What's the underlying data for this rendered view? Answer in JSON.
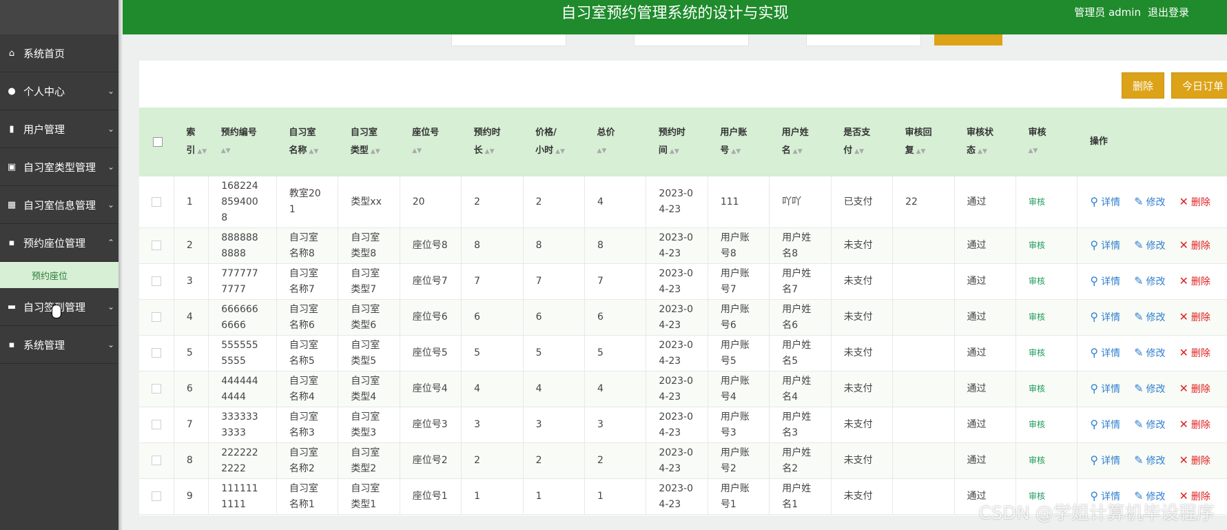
{
  "header": {
    "title": "自习室预约管理系统的设计与实现",
    "user": "管理员 admin",
    "logout": "退出登录"
  },
  "sidebar": {
    "items": [
      {
        "label": "系统首页",
        "icon": "home-icon",
        "glyph": "⌂",
        "arrow": ""
      },
      {
        "label": "个人中心",
        "icon": "user-icon",
        "glyph": "●",
        "arrow": "⌄"
      },
      {
        "label": "用户管理",
        "icon": "user-manage-icon",
        "glyph": "▮",
        "arrow": "⌄"
      },
      {
        "label": "自习室类型管理",
        "icon": "clipboard-icon",
        "glyph": "▣",
        "arrow": "⌄"
      },
      {
        "label": "自习室信息管理",
        "icon": "grid-icon",
        "glyph": "▦",
        "arrow": "⌄"
      },
      {
        "label": "预约座位管理",
        "icon": "apps-icon",
        "glyph": "▪",
        "arrow": "⌃"
      },
      {
        "label": "自习签到管理",
        "icon": "signin-icon",
        "glyph": "▬",
        "arrow": "⌄"
      },
      {
        "label": "系统管理",
        "icon": "system-icon",
        "glyph": "▪",
        "arrow": "⌄"
      }
    ],
    "subitem": "预约座位"
  },
  "toolbar": {
    "delete_label": "删除",
    "today_label": "今日订单"
  },
  "table": {
    "columns": [
      {
        "l1": "索",
        "l2": "引"
      },
      {
        "l1": "预约编号",
        "l2": ""
      },
      {
        "l1": "自习室",
        "l2": "名称"
      },
      {
        "l1": "自习室",
        "l2": "类型"
      },
      {
        "l1": "座位号",
        "l2": ""
      },
      {
        "l1": "预约时",
        "l2": "长"
      },
      {
        "l1": "价格/",
        "l2": "小时"
      },
      {
        "l1": "总价",
        "l2": ""
      },
      {
        "l1": "预约时",
        "l2": "间"
      },
      {
        "l1": "用户账",
        "l2": "号"
      },
      {
        "l1": "用户姓",
        "l2": "名"
      },
      {
        "l1": "是否支",
        "l2": "付"
      },
      {
        "l1": "审核回",
        "l2": "复"
      },
      {
        "l1": "审核状",
        "l2": "态"
      },
      {
        "l1": "审核",
        "l2": ""
      },
      {
        "l1": "操作",
        "l2": ""
      }
    ],
    "actions": {
      "detail": "详情",
      "edit": "修改",
      "delete": "删除"
    },
    "rows": [
      {
        "idx": "1",
        "code": "1682248594008",
        "room": "教室201",
        "type": "类型xx",
        "seat": "20",
        "hours": "2",
        "price": "2",
        "total": "4",
        "time": "2023-04-23",
        "account": "111",
        "name": "吖吖",
        "paid": "已支付",
        "reply": "22",
        "status": "通过",
        "audit": "审核"
      },
      {
        "idx": "2",
        "code": "8888888888",
        "room": "自习室名称8",
        "type": "自习室类型8",
        "seat": "座位号8",
        "hours": "8",
        "price": "8",
        "total": "8",
        "time": "2023-04-23",
        "account": "用户账号8",
        "name": "用户姓名8",
        "paid": "未支付",
        "reply": "",
        "status": "通过",
        "audit": "审核"
      },
      {
        "idx": "3",
        "code": "7777777777",
        "room": "自习室名称7",
        "type": "自习室类型7",
        "seat": "座位号7",
        "hours": "7",
        "price": "7",
        "total": "7",
        "time": "2023-04-23",
        "account": "用户账号7",
        "name": "用户姓名7",
        "paid": "未支付",
        "reply": "",
        "status": "通过",
        "audit": "审核"
      },
      {
        "idx": "4",
        "code": "6666666666",
        "room": "自习室名称6",
        "type": "自习室类型6",
        "seat": "座位号6",
        "hours": "6",
        "price": "6",
        "total": "6",
        "time": "2023-04-23",
        "account": "用户账号6",
        "name": "用户姓名6",
        "paid": "未支付",
        "reply": "",
        "status": "通过",
        "audit": "审核"
      },
      {
        "idx": "5",
        "code": "5555555555",
        "room": "自习室名称5",
        "type": "自习室类型5",
        "seat": "座位号5",
        "hours": "5",
        "price": "5",
        "total": "5",
        "time": "2023-04-23",
        "account": "用户账号5",
        "name": "用户姓名5",
        "paid": "未支付",
        "reply": "",
        "status": "通过",
        "audit": "审核"
      },
      {
        "idx": "6",
        "code": "4444444444",
        "room": "自习室名称4",
        "type": "自习室类型4",
        "seat": "座位号4",
        "hours": "4",
        "price": "4",
        "total": "4",
        "time": "2023-04-23",
        "account": "用户账号4",
        "name": "用户姓名4",
        "paid": "未支付",
        "reply": "",
        "status": "通过",
        "audit": "审核"
      },
      {
        "idx": "7",
        "code": "3333333333",
        "room": "自习室名称3",
        "type": "自习室类型3",
        "seat": "座位号3",
        "hours": "3",
        "price": "3",
        "total": "3",
        "time": "2023-04-23",
        "account": "用户账号3",
        "name": "用户姓名3",
        "paid": "未支付",
        "reply": "",
        "status": "通过",
        "audit": "审核"
      },
      {
        "idx": "8",
        "code": "2222222222",
        "room": "自习室名称2",
        "type": "自习室类型2",
        "seat": "座位号2",
        "hours": "2",
        "price": "2",
        "total": "2",
        "time": "2023-04-23",
        "account": "用户账号2",
        "name": "用户姓名2",
        "paid": "未支付",
        "reply": "",
        "status": "通过",
        "audit": "审核"
      },
      {
        "idx": "9",
        "code": "1111111111",
        "room": "自习室名称1",
        "type": "自习室类型1",
        "seat": "座位号1",
        "hours": "1",
        "price": "1",
        "total": "1",
        "time": "2023-04-23",
        "account": "用户账号1",
        "name": "用户姓名1",
        "paid": "未支付",
        "reply": "",
        "status": "通过",
        "audit": "审核"
      }
    ]
  },
  "watermark": "CSDN @学姐计算机毕设程序"
}
